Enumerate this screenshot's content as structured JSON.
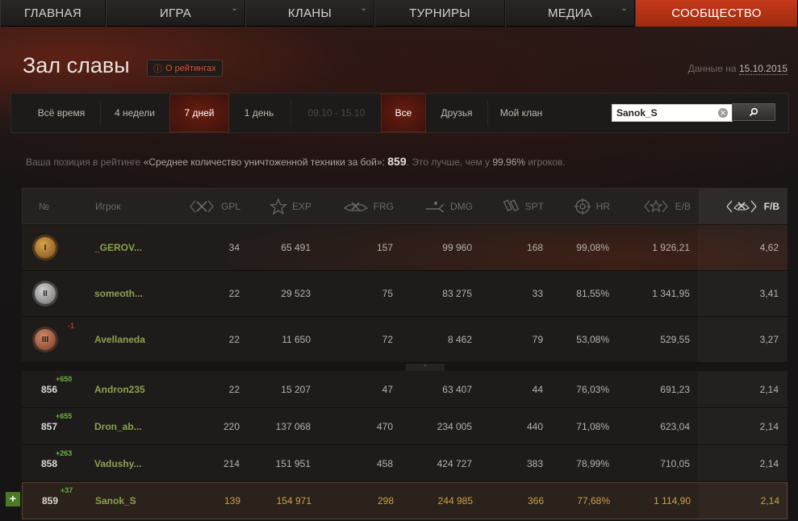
{
  "nav": {
    "items": [
      {
        "label": "Главная",
        "has_menu": false
      },
      {
        "label": "Игра",
        "has_menu": true
      },
      {
        "label": "Кланы",
        "has_menu": true
      },
      {
        "label": "Турниры",
        "has_menu": false
      },
      {
        "label": "Медиа",
        "has_menu": true
      },
      {
        "label": "Сообщество",
        "has_menu": false,
        "active": true
      }
    ]
  },
  "header": {
    "title": "Зал славы",
    "rating_link": "О рейтингах",
    "data_label": "Данные на",
    "data_date": "15.10.2015"
  },
  "filters": {
    "periods": [
      "Всё время",
      "4 недели",
      "7 дней",
      "1 день"
    ],
    "active_period": "7 дней",
    "date_range": "09.10 - 15.10",
    "scopes": [
      "Все",
      "Друзья",
      "Мой клан"
    ],
    "active_scope": "Все",
    "search_value": "Sanok_S",
    "search_button_icon": "search-icon"
  },
  "position": {
    "prefix": "Ваша позиция в рейтинге",
    "category": "«Среднее количество уничтоженной техники за бой»:",
    "rank": "859",
    "text_better": ". Это лучше, чем у",
    "percent": "99.96%",
    "suffix": "игроков."
  },
  "table": {
    "headers": {
      "num": "№",
      "player": "Игрок",
      "gpl": "GPL",
      "exp": "EXP",
      "frg": "FRG",
      "dmg": "DMG",
      "spt": "SPT",
      "hr": "HR",
      "eb": "E/B",
      "fb": "F/B"
    },
    "sorted_column": "fb",
    "top_rows": [
      {
        "medal": "I",
        "medal_type": "gold",
        "delta": "",
        "player": "_GEROV...",
        "gpl": "34",
        "exp": "65 491",
        "frg": "157",
        "dmg": "99 960",
        "spt": "168",
        "hr": "99,08%",
        "eb": "1 926,21",
        "fb": "4,62"
      },
      {
        "medal": "II",
        "medal_type": "silver",
        "delta": "",
        "player": "someoth...",
        "gpl": "22",
        "exp": "29 523",
        "frg": "75",
        "dmg": "83 275",
        "spt": "33",
        "hr": "81,55%",
        "eb": "1 341,95",
        "fb": "3,41"
      },
      {
        "medal": "III",
        "medal_type": "bronze",
        "delta": "-1",
        "player": "Avellaneda",
        "gpl": "22",
        "exp": "11 650",
        "frg": "72",
        "dmg": "8 462",
        "spt": "79",
        "hr": "53,08%",
        "eb": "529,55",
        "fb": "3,27"
      }
    ],
    "rows": [
      {
        "rank": "856",
        "delta": "+650",
        "player": "Andron235",
        "gpl": "22",
        "exp": "15 207",
        "frg": "47",
        "dmg": "63 407",
        "spt": "44",
        "hr": "76,03%",
        "eb": "691,23",
        "fb": "2,14"
      },
      {
        "rank": "857",
        "delta": "+655",
        "player": "Dron_ab...",
        "gpl": "220",
        "exp": "137 068",
        "frg": "470",
        "dmg": "234 005",
        "spt": "440",
        "hr": "71,08%",
        "eb": "623,04",
        "fb": "2,14"
      },
      {
        "rank": "858",
        "delta": "+263",
        "player": "Vadushy...",
        "gpl": "214",
        "exp": "151 951",
        "frg": "458",
        "dmg": "424 727",
        "spt": "383",
        "hr": "78,99%",
        "eb": "710,05",
        "fb": "2,14"
      },
      {
        "rank": "859",
        "delta": "+37",
        "player": "Sanok_S",
        "gpl": "139",
        "exp": "154 971",
        "frg": "298",
        "dmg": "244 985",
        "spt": "366",
        "hr": "77,68%",
        "eb": "1 114,90",
        "fb": "2,14",
        "is_self": true
      }
    ],
    "add_button": "+"
  },
  "colors": {
    "accent_red": "#c53a1a",
    "player_green": "#8aa24e",
    "delta_green": "#6cb23e",
    "delta_red": "#c4351c",
    "self_gold": "#c9a24a"
  }
}
